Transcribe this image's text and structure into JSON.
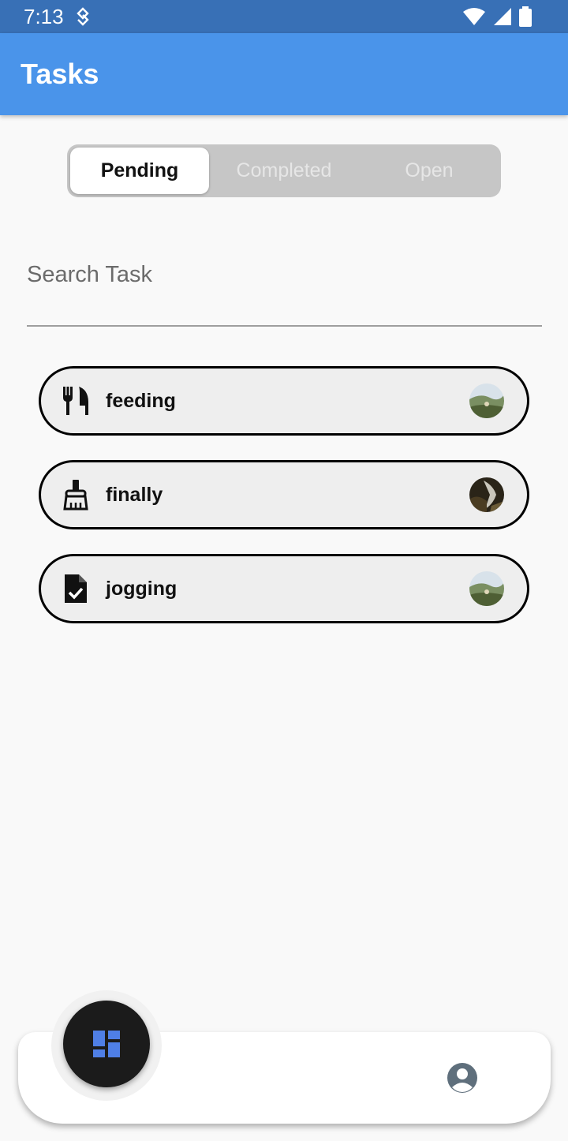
{
  "status_bar": {
    "time": "7:13"
  },
  "app_bar": {
    "title": "Tasks"
  },
  "segments": {
    "pending": "Pending",
    "completed": "Completed",
    "open": "Open"
  },
  "search": {
    "placeholder": "Search Task",
    "value": ""
  },
  "tasks": [
    {
      "label": "feeding",
      "icon": "utensils-icon"
    },
    {
      "label": "finally",
      "icon": "broom-icon"
    },
    {
      "label": "jogging",
      "icon": "task-file-icon"
    }
  ],
  "bottom_nav": {
    "fab_icon": "dashboard-icon",
    "profile_icon": "account-circle-icon"
  },
  "colors": {
    "accent": "#4a94ea",
    "status_bar": "#3870b6",
    "fab_icon": "#4f7fe6",
    "profile_icon": "#5f6f7c"
  }
}
